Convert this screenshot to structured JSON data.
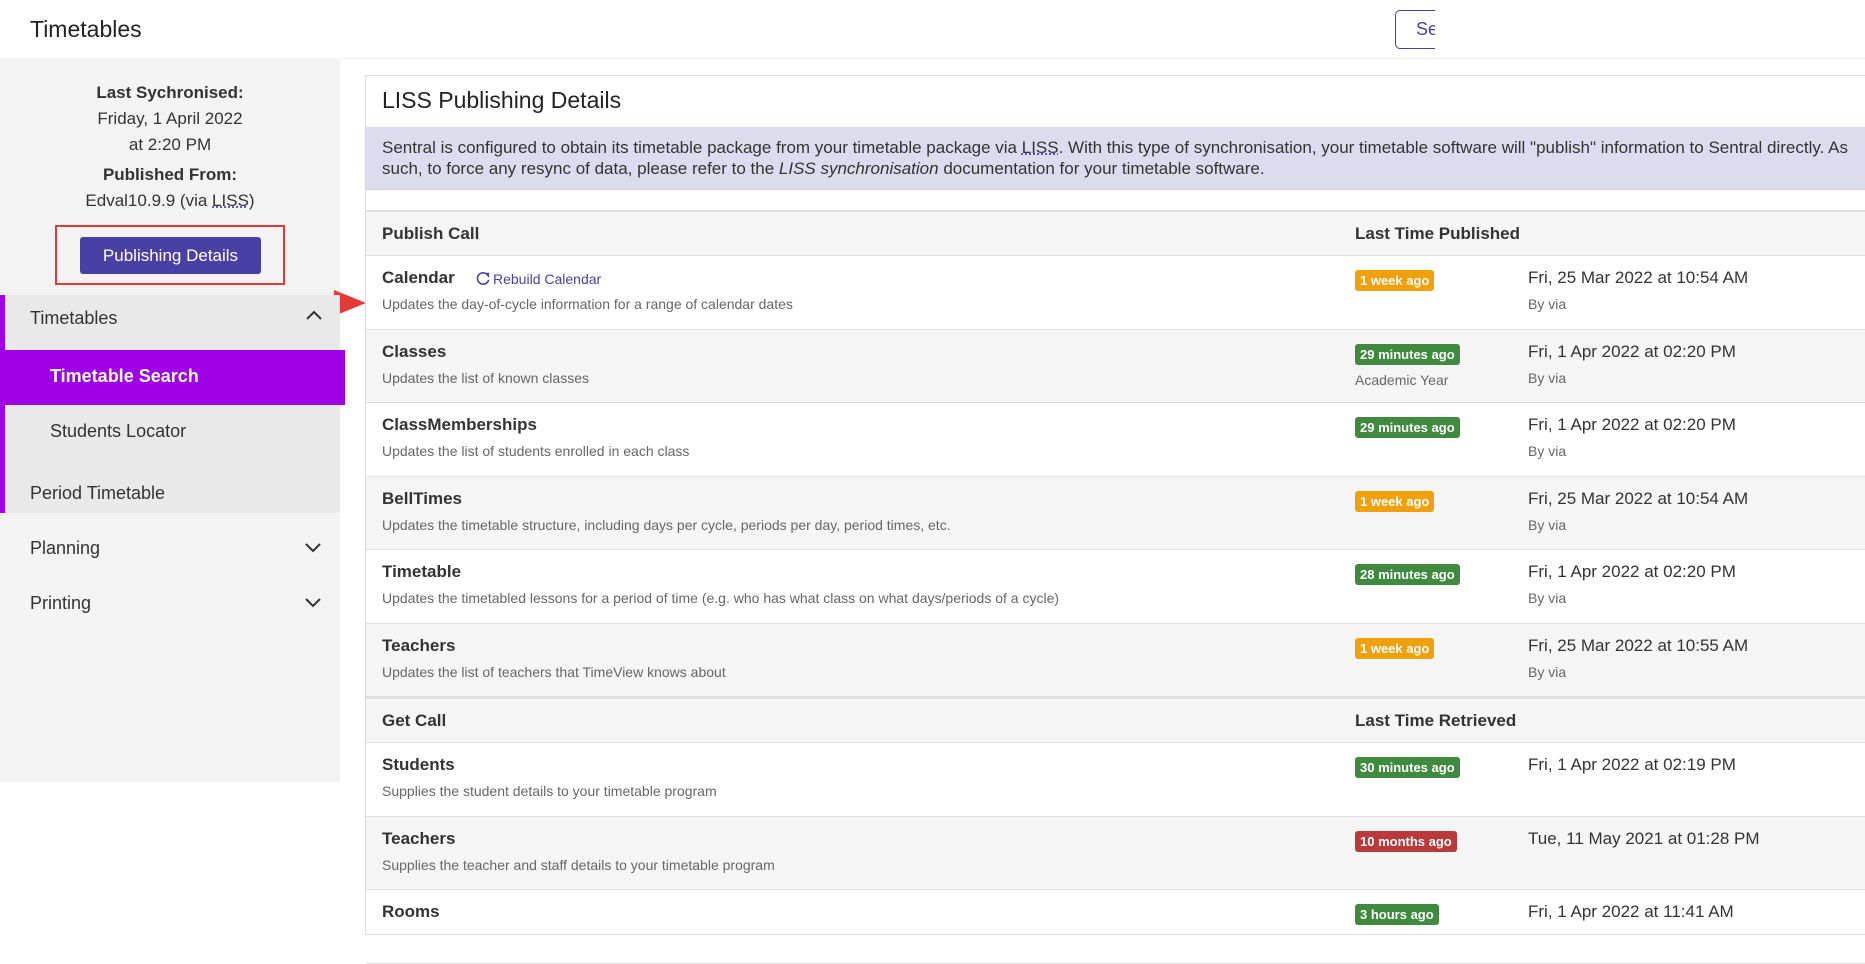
{
  "header": {
    "title": "Timetables",
    "search_label": "Se"
  },
  "sidebar": {
    "last_sync_label": "Last Sychronised:",
    "last_sync_date": "Friday, 1 April 2022",
    "last_sync_time": "at 2:20 PM",
    "published_from_label": "Published From:",
    "published_from_value": "Edval10.9.9 (via ",
    "published_from_abbr": "LISS",
    "published_from_close": ")",
    "publishing_details_button": "Publishing Details",
    "nav": {
      "timetables": "Timetables",
      "timetable_search": "Timetable Search",
      "students_locator": "Students Locator",
      "period_timetable": "Period Timetable",
      "planning": "Planning",
      "printing": "Printing"
    }
  },
  "main": {
    "title": "LISS Publishing Details",
    "info_text_1": "Sentral is configured to obtain its timetable package from your timetable package via ",
    "info_abbr": "LISS",
    "info_text_2": ". With this type of synchronisation, your timetable software will \"publish\" information to Sentral directly. As such, to force any resync of data, please refer to the ",
    "info_em": "LISS synchronisation",
    "info_text_3": " documentation for your timetable software.",
    "publish_section": {
      "col1": "Publish Call",
      "col2": "Last Time Published",
      "rebuild_label": "Rebuild Calendar",
      "rows": [
        {
          "name": "Calendar",
          "desc": "Updates the day-of-cycle information for a range of calendar dates",
          "badge": "1 week ago",
          "badge_color": "#f0a00a",
          "extra": "",
          "when": "Fri, 25 Mar 2022 at 10:54 AM",
          "by": "By via"
        },
        {
          "name": "Classes",
          "desc": "Updates the list of known classes",
          "badge": "29 minutes ago",
          "badge_color": "#3f8a3f",
          "extra": "Academic Year",
          "when": "Fri, 1 Apr 2022 at 02:20 PM",
          "by": "By via"
        },
        {
          "name": "ClassMemberships",
          "desc": "Updates the list of students enrolled in each class",
          "badge": "29 minutes ago",
          "badge_color": "#3f8a3f",
          "extra": "",
          "when": "Fri, 1 Apr 2022 at 02:20 PM",
          "by": "By via"
        },
        {
          "name": "BellTimes",
          "desc": "Updates the timetable structure, including days per cycle, periods per day, period times, etc.",
          "badge": "1 week ago",
          "badge_color": "#f0a00a",
          "extra": "",
          "when": "Fri, 25 Mar 2022 at 10:54 AM",
          "by": "By via"
        },
        {
          "name": "Timetable",
          "desc": "Updates the timetabled lessons for a period of time (e.g. who has what class on what days/periods of a cycle)",
          "badge": "28 minutes ago",
          "badge_color": "#3f8a3f",
          "extra": "",
          "when": "Fri, 1 Apr 2022 at 02:20 PM",
          "by": "By via"
        },
        {
          "name": "Teachers",
          "desc": "Updates the list of teachers that TimeView knows about",
          "badge": "1 week ago",
          "badge_color": "#f0a00a",
          "extra": "",
          "when": "Fri, 25 Mar 2022 at 10:55 AM",
          "by": "By via"
        }
      ]
    },
    "get_section": {
      "col1": "Get Call",
      "col2": "Last Time Retrieved",
      "rows": [
        {
          "name": "Students",
          "desc": "Supplies the student details to your timetable program",
          "badge": "30 minutes ago",
          "badge_color": "#3f8a3f",
          "when": "Fri, 1 Apr 2022 at 02:19 PM"
        },
        {
          "name": "Teachers",
          "desc": "Supplies the teacher and staff details to your timetable program",
          "badge": "10 months ago",
          "badge_color": "#b83a3a",
          "when": "Tue, 11 May 2021 at 01:28 PM"
        },
        {
          "name": "Rooms",
          "desc": "",
          "badge": "3 hours ago",
          "badge_color": "#3f8a3f",
          "when": "Fri, 1 Apr 2022 at 11:41 AM"
        }
      ]
    }
  }
}
